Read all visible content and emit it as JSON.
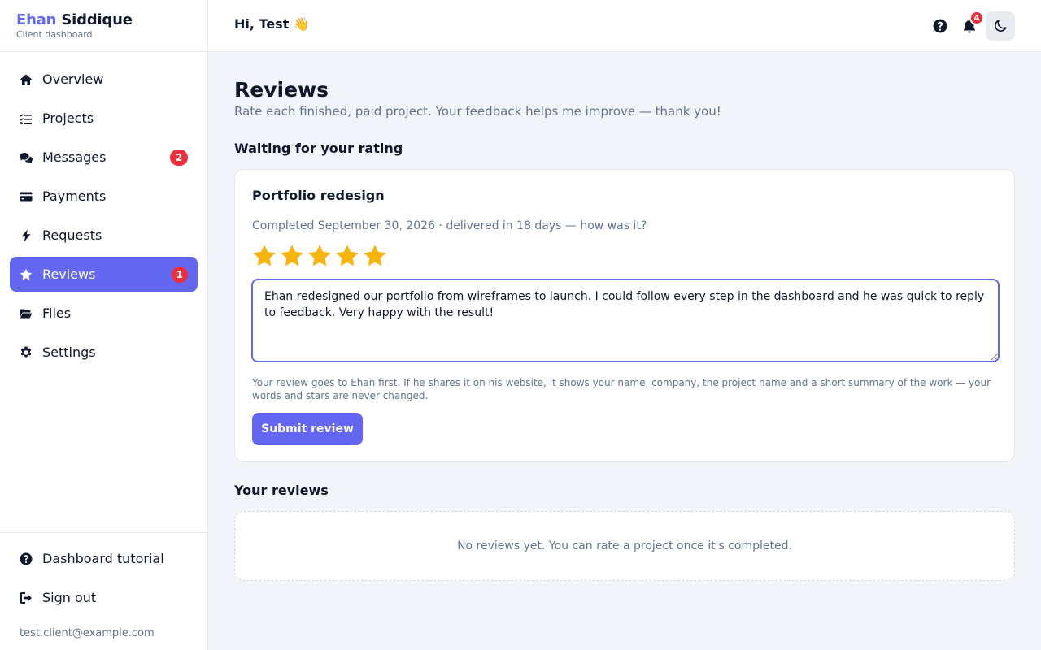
{
  "brand": {
    "first": "Ehan",
    "last": "Siddique",
    "subtitle": "Client dashboard"
  },
  "sidebar": {
    "items": [
      {
        "label": "Overview",
        "icon": "home-icon"
      },
      {
        "label": "Projects",
        "icon": "list-check-icon"
      },
      {
        "label": "Messages",
        "icon": "chat-icon",
        "badge": "2"
      },
      {
        "label": "Payments",
        "icon": "credit-card-icon"
      },
      {
        "label": "Requests",
        "icon": "bolt-icon"
      },
      {
        "label": "Reviews",
        "icon": "star-icon",
        "badge": "1",
        "active": true
      },
      {
        "label": "Files",
        "icon": "folder-open-icon"
      },
      {
        "label": "Settings",
        "icon": "gear-icon"
      }
    ],
    "bottom_items": [
      {
        "label": "Dashboard tutorial",
        "icon": "help-circle-icon"
      },
      {
        "label": "Sign out",
        "icon": "sign-out-icon"
      }
    ],
    "user_email": "test.client@example.com"
  },
  "header": {
    "greeting": "Hi, Test 👋",
    "notification_count": "4"
  },
  "main": {
    "title": "Reviews",
    "subtitle": "Rate each finished, paid project. Your feedback helps me improve — thank you!",
    "waiting_heading": "Waiting for your rating",
    "card": {
      "project_name": "Portfolio redesign",
      "meta": "Completed September 30, 2026 · delivered in 18 days — how was it?",
      "rating": 5,
      "rating_max": 5,
      "review_text": "Ehan redesigned our portfolio from wireframes to launch. I could follow every step in the dashboard and he was quick to reply to feedback. Very happy with the result!",
      "note": "Your review goes to Ehan first. If he shares it on his website, it shows your name, company, the project name and a short summary of the work — your words and stars are never changed.",
      "submit_label": "Submit review"
    },
    "your_reviews_heading": "Your reviews",
    "empty_text": "No reviews yet. You can rate a project once it's completed."
  },
  "colors": {
    "accent": "#6366f1",
    "badge": "#ef2d3b",
    "star": "#f5b50a"
  }
}
